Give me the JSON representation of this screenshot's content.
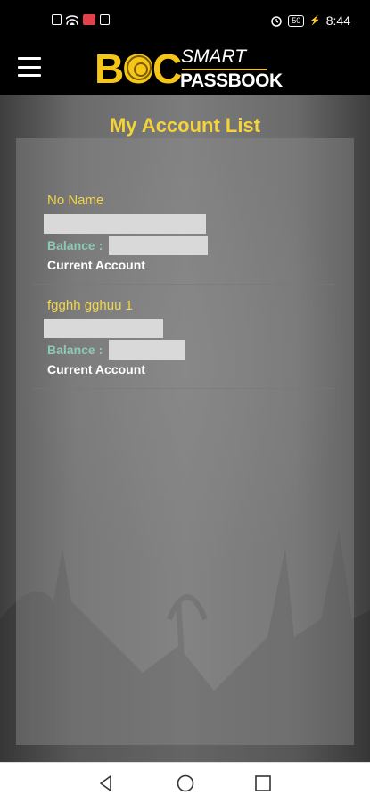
{
  "status_bar": {
    "time": "8:44",
    "battery": "50"
  },
  "header": {
    "logo_boc": "BOC",
    "logo_smart": "SMART",
    "logo_passbook": "PASSBOOK"
  },
  "page": {
    "title": "My Account List"
  },
  "accounts": [
    {
      "name": "No Name",
      "balance_label": "Balance :",
      "type": "Current Account"
    },
    {
      "name": "fgghh gghuu 1",
      "balance_label": "Balance :",
      "type": "Current Account"
    }
  ],
  "nav": {
    "back_icon": "back-triangle-icon",
    "home_icon": "home-circle-icon",
    "recents_icon": "recents-square-icon"
  }
}
